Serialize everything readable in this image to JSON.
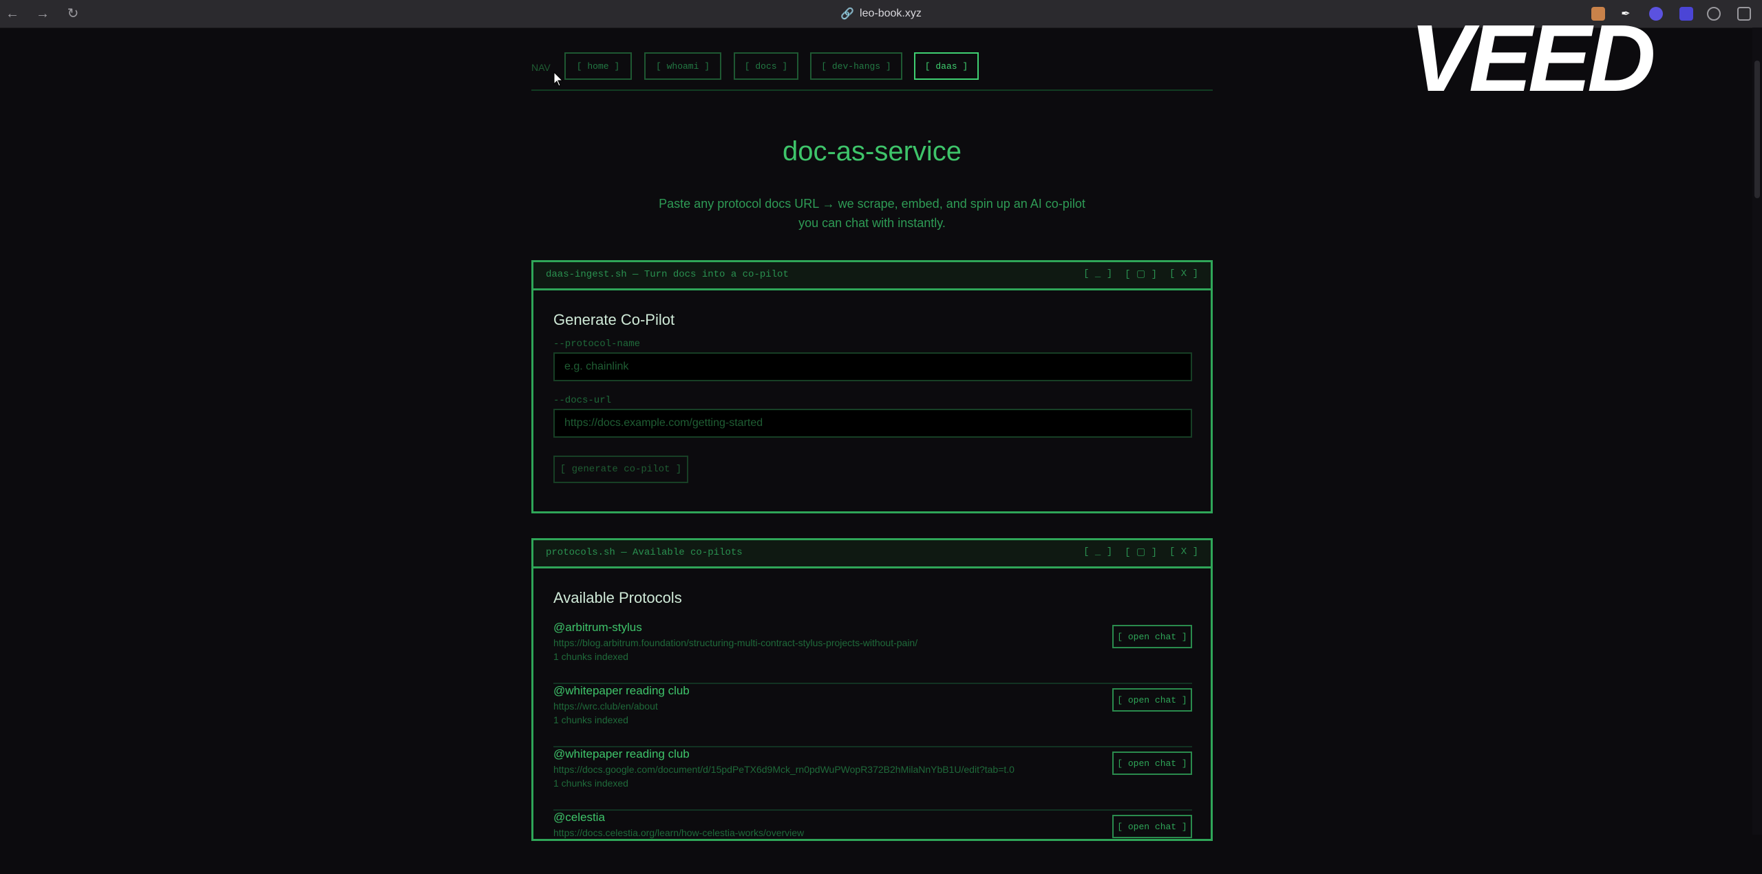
{
  "browser": {
    "url": "leo-book.xyz",
    "back_icon": "back-arrow-icon",
    "forward_icon": "forward-arrow-icon",
    "reload_icon": "reload-icon"
  },
  "watermark": {
    "text": "VEED"
  },
  "nav": {
    "label": "NAV",
    "items": [
      {
        "label": "[ home ]"
      },
      {
        "label": "[ whoami ]"
      },
      {
        "label": "[ docs ]"
      },
      {
        "label": "[ dev-hangs ]"
      },
      {
        "label": "[ daas ]",
        "active": true
      }
    ]
  },
  "hero": {
    "title": "doc-as-service",
    "subtitle_line1": "Paste any protocol docs URL → we scrape, embed, and spin up an AI co-pilot",
    "subtitle_line2": "you can chat with instantly."
  },
  "ingest_window": {
    "title": "daas-ingest.sh — Turn docs into a co-pilot",
    "controls": [
      "[ _ ]",
      "[ ▢ ]",
      "[ X ]"
    ],
    "heading": "Generate Co-Pilot",
    "protocol_label": "--protocol-name",
    "protocol_placeholder": "e.g. chainlink",
    "docs_label": "--docs-url",
    "docs_placeholder": "https://docs.example.com/getting-started",
    "generate_label": "[ generate co-pilot ]"
  },
  "protocols_window": {
    "title": "protocols.sh — Available co-pilots",
    "controls": [
      "[ _ ]",
      "[ ▢ ]",
      "[ X ]"
    ],
    "heading": "Available Protocols",
    "open_label": "[ open chat ]",
    "items": [
      {
        "name": "@arbitrum-stylus",
        "url": "https://blog.arbitrum.foundation/structuring-multi-contract-stylus-projects-without-pain/",
        "chunks": "1 chunks indexed"
      },
      {
        "name": "@whitepaper reading club",
        "url": "https://wrc.club/en/about",
        "chunks": "1 chunks indexed"
      },
      {
        "name": "@whitepaper reading club",
        "url": "https://docs.google.com/document/d/15pdPeTX6d9Mck_rn0pdWuPWopR372B2hMilaNnYbB1U/edit?tab=t.0",
        "chunks": "1 chunks indexed"
      },
      {
        "name": "@celestia",
        "url": "https://docs.celestia.org/learn/how-celestia-works/overview",
        "chunks": ""
      }
    ]
  }
}
